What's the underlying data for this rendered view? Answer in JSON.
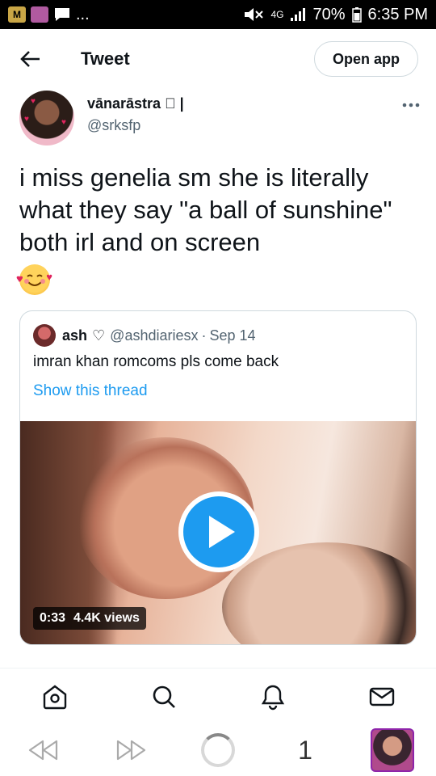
{
  "status_bar": {
    "battery": "70%",
    "time": "6:35 PM",
    "network": "4G",
    "overflow": "..."
  },
  "header": {
    "title": "Tweet",
    "open_app_label": "Open app"
  },
  "tweet": {
    "display_name": "vānarāstra \u0000 |",
    "handle": "@srksfp",
    "text": "i miss genelia sm she is literally what they say \"a ball of sunshine\" both irl and on screen",
    "emoji": "smiling-face-with-hearts"
  },
  "quote": {
    "name": "ash",
    "handle": "@ashdiariesx",
    "separator": "·",
    "date": "Sep 14",
    "text": "imran khan romcoms pls come back",
    "show_thread": "Show this thread",
    "video": {
      "duration": "0:33",
      "views": "4.4K views"
    }
  },
  "nav": [
    "home-icon",
    "search-icon",
    "notifications-icon",
    "messages-icon"
  ],
  "browser": {
    "tab_count": "1"
  },
  "colors": {
    "accent": "#1d9bf0",
    "text": "#0f1419",
    "secondary": "#536471"
  }
}
